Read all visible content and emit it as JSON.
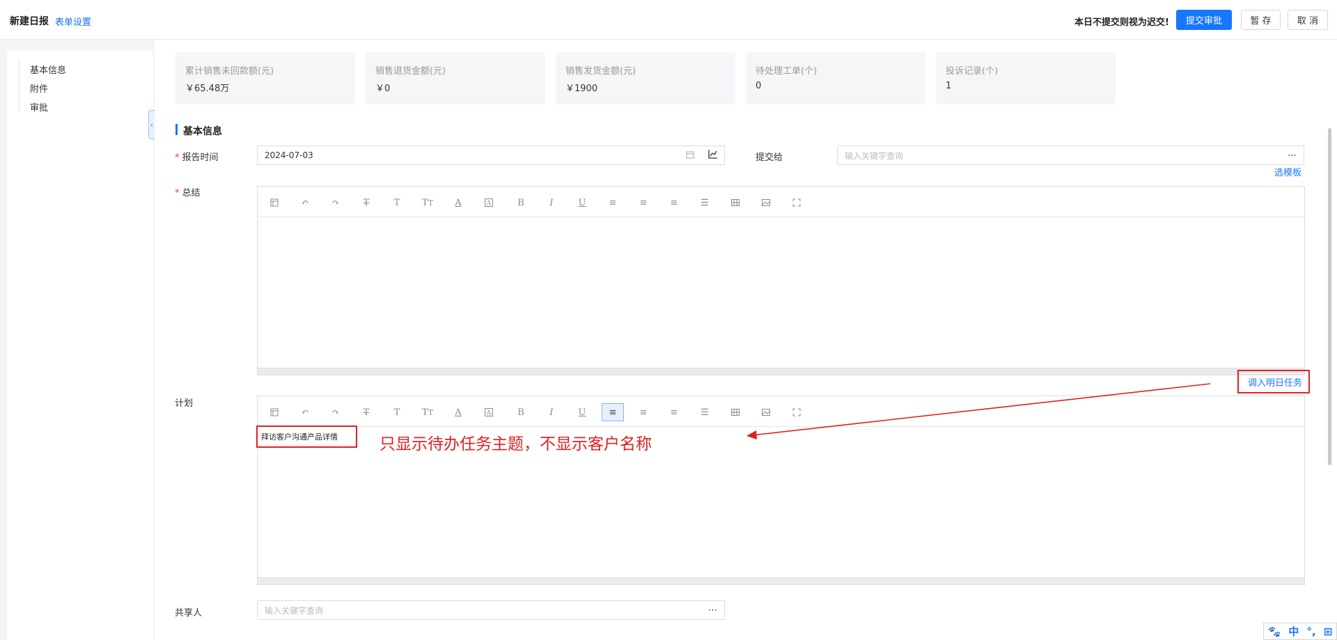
{
  "header": {
    "title": "新建日报",
    "form_settings": "表单设置",
    "warning": "本日不提交则视为迟交!",
    "submit_label": "提交审批",
    "save_label": "暂 存",
    "cancel_label": "取 消",
    "primary_color": "#1677ff"
  },
  "sidebar": {
    "items": [
      {
        "label": "基本信息"
      },
      {
        "label": "附件"
      },
      {
        "label": "审批"
      }
    ],
    "collapse_icon": "chevron-left-icon"
  },
  "stats": [
    {
      "label": "累计销售未回款额(元)",
      "value": "￥65.48万"
    },
    {
      "label": "销售退货金额(元)",
      "value": "￥0"
    },
    {
      "label": "销售发货金额(元)",
      "value": "￥1900"
    },
    {
      "label": "待处理工单(个)",
      "value": "0"
    },
    {
      "label": "投诉记录(个)",
      "value": "1"
    }
  ],
  "section": {
    "title": "基本信息"
  },
  "form": {
    "report_time_label": "报告时间",
    "report_time_value": "2024-07-03",
    "submit_to_label": "提交给",
    "submit_to_placeholder": "输入关键字查询",
    "select_template": "选模板",
    "summary_label": "总结",
    "plan_label": "计划",
    "import_tasks": "调入明日任务",
    "plan_content": "拜访客户沟通产品详情",
    "share_label": "共享人",
    "share_placeholder": "输入关键字查询",
    "more_icon": "ellipsis-icon",
    "calendar_icon": "calendar-icon",
    "chart_icon": "line-chart-icon"
  },
  "editor_toolbar": [
    "format-icon",
    "undo-icon",
    "redo-icon",
    "strikethrough-icon",
    "text-icon",
    "font-size-icon",
    "font-color-icon",
    "background-color-icon",
    "bold-icon",
    "italic-icon",
    "underline-icon",
    "align-left-icon",
    "align-center-icon",
    "align-right-icon",
    "justify-icon",
    "table-icon",
    "image-icon",
    "fullscreen-icon"
  ],
  "annotation": {
    "text": "只显示待办任务主题，不显示客户名称",
    "color": "#e02020"
  },
  "ime": {
    "lang": "中",
    "punct": "°,"
  }
}
